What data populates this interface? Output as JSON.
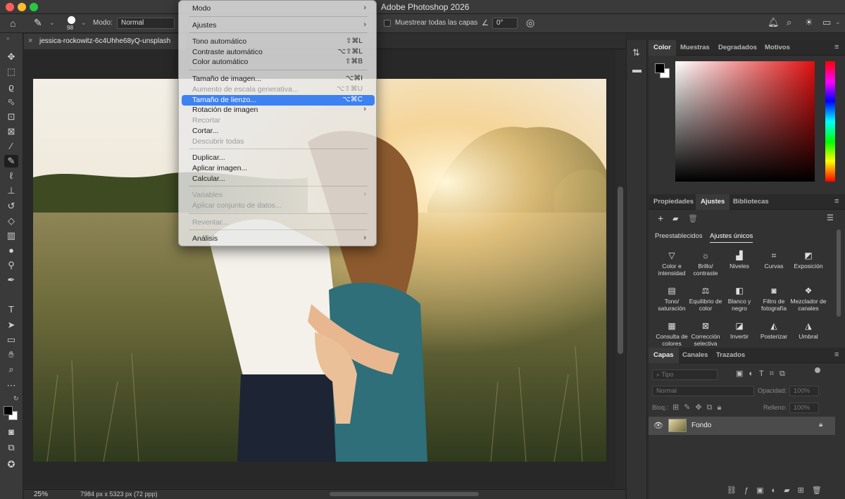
{
  "app": {
    "title": "Adobe Photoshop 2026"
  },
  "options_bar": {
    "brush_size": "98",
    "mode_label": "Modo:",
    "mode_value": "Normal",
    "sample_all_label": "Muestrear todas las capas",
    "angle_value": "0°"
  },
  "document": {
    "tab_label": "jessica-rockowitz-6c4Uhhe68yQ-unsplash",
    "zoom": "25%",
    "size_info": "7984 px x 5323 px (72 ppp)"
  },
  "menu": {
    "items": [
      {
        "label": "Modo",
        "shortcut": "",
        "submenu": true,
        "disabled": false,
        "highlighted": false
      },
      {
        "label": "Ajustes",
        "shortcut": "",
        "submenu": true,
        "disabled": false,
        "highlighted": false
      },
      {
        "label": "Tono automático",
        "shortcut": "⇧⌘L",
        "submenu": false,
        "disabled": false,
        "highlighted": false
      },
      {
        "label": "Contraste automático",
        "shortcut": "⌥⇧⌘L",
        "submenu": false,
        "disabled": false,
        "highlighted": false
      },
      {
        "label": "Color automático",
        "shortcut": "⇧⌘B",
        "submenu": false,
        "disabled": false,
        "highlighted": false
      },
      {
        "label": "Tamaño de imagen...",
        "shortcut": "⌥⌘I",
        "submenu": false,
        "disabled": false,
        "highlighted": false
      },
      {
        "label": "Aumento de escala generativa...",
        "shortcut": "⌥⇧⌘U",
        "submenu": false,
        "disabled": true,
        "highlighted": false
      },
      {
        "label": "Tamaño de lienzo...",
        "shortcut": "⌥⌘C",
        "submenu": false,
        "disabled": false,
        "highlighted": true
      },
      {
        "label": "Rotación de imagen",
        "shortcut": "",
        "submenu": true,
        "disabled": false,
        "highlighted": false
      },
      {
        "label": "Recortar",
        "shortcut": "",
        "submenu": false,
        "disabled": true,
        "highlighted": false
      },
      {
        "label": "Cortar...",
        "shortcut": "",
        "submenu": false,
        "disabled": false,
        "highlighted": false
      },
      {
        "label": "Descubrir todas",
        "shortcut": "",
        "submenu": false,
        "disabled": true,
        "highlighted": false
      },
      {
        "label": "Duplicar...",
        "shortcut": "",
        "submenu": false,
        "disabled": false,
        "highlighted": false
      },
      {
        "label": "Aplicar imagen...",
        "shortcut": "",
        "submenu": false,
        "disabled": false,
        "highlighted": false
      },
      {
        "label": "Calcular...",
        "shortcut": "",
        "submenu": false,
        "disabled": false,
        "highlighted": false
      },
      {
        "label": "Variables",
        "shortcut": "",
        "submenu": true,
        "disabled": true,
        "highlighted": false
      },
      {
        "label": "Aplicar conjunto de datos...",
        "shortcut": "",
        "submenu": false,
        "disabled": true,
        "highlighted": false
      },
      {
        "label": "Reventar...",
        "shortcut": "",
        "submenu": false,
        "disabled": true,
        "highlighted": false
      },
      {
        "label": "Análisis",
        "shortcut": "",
        "submenu": true,
        "disabled": false,
        "highlighted": false
      }
    ]
  },
  "color_panel": {
    "tabs": [
      "Color",
      "Muestras",
      "Degradados",
      "Motivos"
    ],
    "active_tab": "Color"
  },
  "adjust_panel": {
    "tabs": [
      "Propiedades",
      "Ajustes",
      "Bibliotecas"
    ],
    "active_tab": "Ajustes",
    "subtabs": [
      "Preestablecidos",
      "Ajustes únicos"
    ],
    "active_subtab": "Ajustes únicos",
    "items": [
      {
        "label": "Color e intensidad",
        "icon": "triangle-down-icon"
      },
      {
        "label": "Brillo/ contraste",
        "icon": "sun-icon"
      },
      {
        "label": "Niveles",
        "icon": "levels-icon"
      },
      {
        "label": "Curvas",
        "icon": "curves-icon"
      },
      {
        "label": "Exposición",
        "icon": "exposure-icon"
      },
      {
        "label": "Tono/ saturación",
        "icon": "hue-saturation-icon"
      },
      {
        "label": "Equilibrio de color",
        "icon": "balance-icon"
      },
      {
        "label": "Blanco y negro",
        "icon": "black-white-icon"
      },
      {
        "label": "Filtro de fotografía",
        "icon": "camera-filter-icon"
      },
      {
        "label": "Mezclador de canales",
        "icon": "channel-mixer-icon"
      },
      {
        "label": "Consulta de colores",
        "icon": "color-lookup-icon"
      },
      {
        "label": "Corrección selectiva",
        "icon": "selective-color-icon"
      },
      {
        "label": "Invertir",
        "icon": "invert-icon"
      },
      {
        "label": "Posterizar",
        "icon": "posterize-icon"
      },
      {
        "label": "Umbral",
        "icon": "threshold-icon"
      }
    ]
  },
  "layers_panel": {
    "tabs": [
      "Capas",
      "Canales",
      "Trazados"
    ],
    "active_tab": "Capas",
    "kind_placeholder": "Tipo",
    "blend_mode": "Normal",
    "opacity_label": "Opacidad:",
    "opacity_value": "100%",
    "lock_label": "Bloq.:",
    "fill_label": "Relleno:",
    "fill_value": "100%",
    "layers": [
      {
        "name": "Fondo",
        "visible": true,
        "locked": true
      }
    ]
  },
  "colors": {
    "menu_highlight": "#3d82f0",
    "panel_bg": "#323232",
    "foreground": "#000000",
    "background": "#ffffff"
  }
}
